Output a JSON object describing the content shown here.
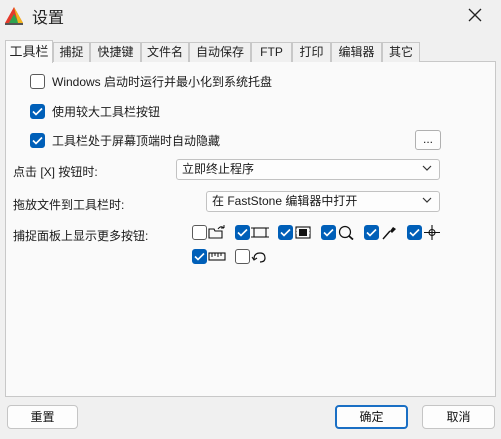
{
  "window": {
    "title": "设置"
  },
  "tabs": [
    {
      "label": "工具栏",
      "active": true
    },
    {
      "label": "捕捉"
    },
    {
      "label": "快捷键"
    },
    {
      "label": "文件名"
    },
    {
      "label": "自动保存"
    },
    {
      "label": "FTP"
    },
    {
      "label": "打印"
    },
    {
      "label": "编辑器"
    },
    {
      "label": "其它"
    }
  ],
  "options": {
    "startup_minimize": {
      "label": "Windows 启动时运行并最小化到系统托盘",
      "checked": false
    },
    "large_buttons": {
      "label": "使用较大工具栏按钮",
      "checked": true
    },
    "auto_hide": {
      "label": "工具栏处于屏幕顶端时自动隐藏",
      "checked": true
    },
    "auto_hide_more": "..."
  },
  "close_action": {
    "label": "点击 [X] 按钮时:",
    "value": "立即终止程序"
  },
  "drop_action": {
    "label": "拖放文件到工具栏时:",
    "value": "在 FastStone 编辑器中打开"
  },
  "extra_buttons": {
    "label": "捕捉面板上显示更多按钮:",
    "items": [
      {
        "icon": "open-folder-icon",
        "checked": false
      },
      {
        "icon": "fixed-region-icon",
        "checked": true
      },
      {
        "icon": "video-capture-icon",
        "checked": true
      },
      {
        "icon": "magnifier-icon",
        "checked": true
      },
      {
        "icon": "color-picker-icon",
        "checked": true
      },
      {
        "icon": "crosshair-icon",
        "checked": true
      },
      {
        "icon": "ruler-icon",
        "checked": true
      },
      {
        "icon": "delay-icon",
        "checked": false
      }
    ]
  },
  "footer": {
    "reset": "重置",
    "ok": "确定",
    "cancel": "取消"
  },
  "colors": {
    "accent": "#005fb8",
    "primary_border": "#1a6fc4"
  }
}
